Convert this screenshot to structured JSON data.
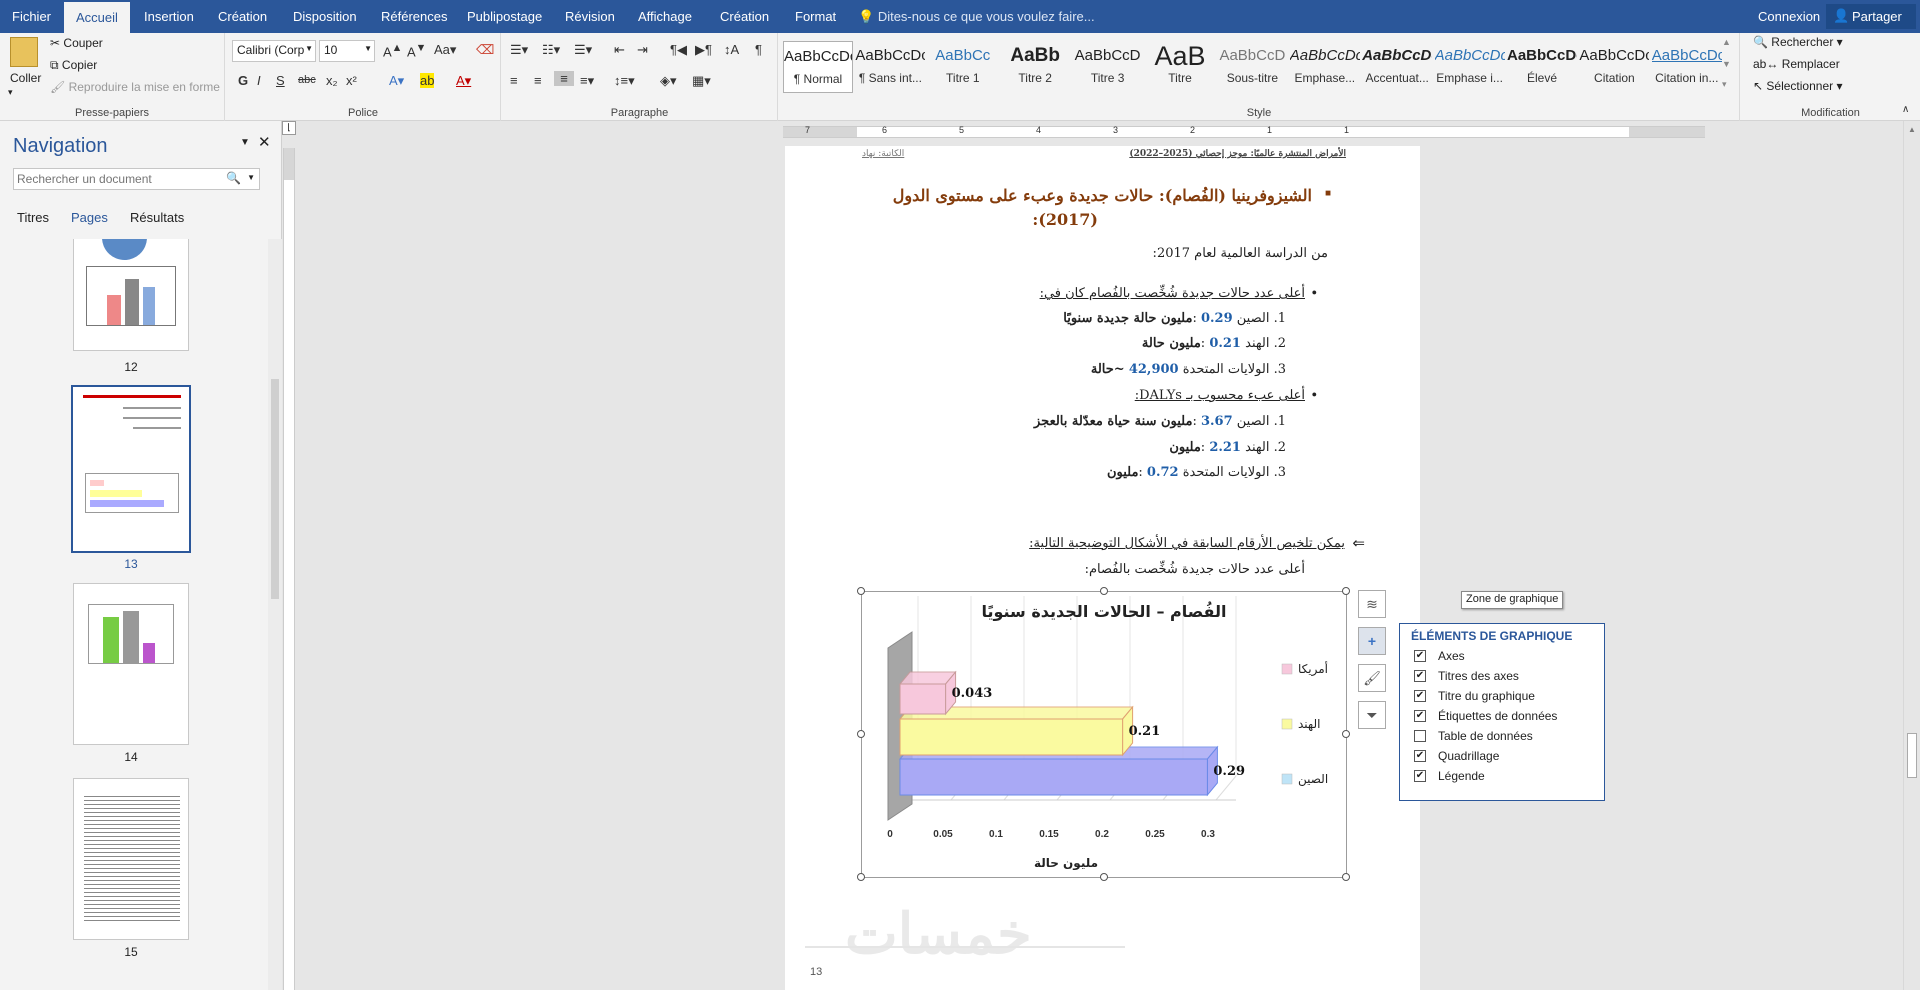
{
  "tabs": {
    "file": "Fichier",
    "home": "Accueil",
    "insert": "Insertion",
    "design": "Création",
    "layout": "Disposition",
    "references": "Références",
    "mailings": "Publipostage",
    "review": "Révision",
    "view": "Affichage",
    "chart_design": "Création",
    "format": "Format",
    "tell_me": "Dites-nous ce que vous voulez faire...",
    "signin": "Connexion",
    "share": "Partager"
  },
  "clipboard": {
    "paste": "Coller",
    "cut": "Couper",
    "copy": "Copier",
    "format_painter": "Reproduire la mise en forme",
    "label": "Presse-papiers"
  },
  "font": {
    "name": "Calibri (Corp",
    "size": "10",
    "label": "Police",
    "bold": "G",
    "italic": "I",
    "underline": "S",
    "strike": "abc",
    "sub": "x₂",
    "sup": "x²"
  },
  "paragraph": {
    "label": "Paragraphe"
  },
  "styles": {
    "label": "Style",
    "items": [
      {
        "preview": "AaBbCcDc",
        "name": "¶ Normal"
      },
      {
        "preview": "AaBbCcDc",
        "name": "¶ Sans int..."
      },
      {
        "preview": "AaBbCc",
        "name": "Titre 1"
      },
      {
        "preview": "AaBb",
        "name": "Titre 2"
      },
      {
        "preview": "AaBbCcD",
        "name": "Titre 3"
      },
      {
        "preview": "AaB",
        "name": "Titre"
      },
      {
        "preview": "AaBbCcD",
        "name": "Sous-titre"
      },
      {
        "preview": "AaBbCcDc",
        "name": "Emphase..."
      },
      {
        "preview": "AaBbCcDc",
        "name": "Accentuat..."
      },
      {
        "preview": "AaBbCcDc",
        "name": "Emphase i..."
      },
      {
        "preview": "AaBbCcDc",
        "name": "Élevé"
      },
      {
        "preview": "AaBbCcDc",
        "name": "Citation"
      },
      {
        "preview": "AaBbCcDc",
        "name": "Citation in..."
      }
    ]
  },
  "editing": {
    "find": "Rechercher",
    "replace": "Remplacer",
    "select": "Sélectionner",
    "label": "Modification"
  },
  "ruler": {
    "numbers": [
      "7",
      "6",
      "5",
      "4",
      "3",
      "2",
      "1",
      "1"
    ]
  },
  "nav": {
    "title": "Navigation",
    "search_placeholder": "Rechercher un document",
    "tabs": [
      "Titres",
      "Pages",
      "Résultats"
    ],
    "pages": [
      "12",
      "13",
      "14",
      "15"
    ]
  },
  "doc": {
    "header_left": "الكاتبة: نهاد",
    "header_right": "الأمراض المنتشرة عالميًا: موجز إحصائي (2025–2022)",
    "heading": "الشيزوفرينيا (الفُصام): حالات جديدة وعبء على مستوى الدول",
    "heading2": "(2017):",
    "source": "من الدراسة العالمية لعام 2017:",
    "bullet1": "أعلى عدد حالات جديدة شُخِّصت بالفُصام كان في:",
    "b1_items": [
      {
        "n": "1.",
        "country": "الصين",
        "val": "0.29",
        "unit": "مليون حالة جديدة سنويًا"
      },
      {
        "n": "2.",
        "country": "الهند",
        "val": "0.21",
        "unit": "مليون حالة"
      },
      {
        "n": "3.",
        "country": "الولايات المتحدة",
        "val": "42,900",
        "unit": "~حالة"
      }
    ],
    "bullet2": "أعلى عبء محسوب بـ DALYs:",
    "b2_items": [
      {
        "n": "1.",
        "country": "الصين",
        "val": "3.67",
        "unit": "مليون سنة حياة معدّلة بالعجز"
      },
      {
        "n": "2.",
        "country": "الهند",
        "val": "2.21",
        "unit": "مليون"
      },
      {
        "n": "3.",
        "country": "الولايات المتحدة",
        "val": "0.72",
        "unit": "مليون"
      }
    ],
    "summary": "يمكن تلخيص الأرقام السابقة في الأشكال التوضيحية التالية:",
    "caption": "أعلى عدد حالات جديدة شُخِّصت بالفُصام:",
    "page_number": "13",
    "watermark": "خمسات"
  },
  "chart_data": {
    "type": "bar",
    "orientation": "horizontal",
    "title": "الفُصام – الحالات الجديدة سنويًا",
    "xlabel": "مليون حالة",
    "categories": [
      "الصين",
      "الهند",
      "أمريكا"
    ],
    "values": [
      0.29,
      0.21,
      0.043
    ],
    "data_labels": [
      "0.29",
      "0.21",
      "0.043"
    ],
    "xlim": [
      0,
      0.3
    ],
    "ticks": [
      "0",
      "0.05",
      "0.1",
      "0.15",
      "0.2",
      "0.25",
      "0.3"
    ],
    "colors": [
      "#a9a9f5",
      "#fafaa0",
      "#f7c8dc"
    ],
    "legend": [
      "أمريكا",
      "الهند",
      "الصين"
    ],
    "legend_position": "right"
  },
  "tooltip": "Zone de graphique",
  "chart_elements": {
    "title": "ÉLÉMENTS DE GRAPHIQUE",
    "items": [
      {
        "label": "Axes",
        "checked": true
      },
      {
        "label": "Titres des axes",
        "checked": true
      },
      {
        "label": "Titre du graphique",
        "checked": true
      },
      {
        "label": "Étiquettes de données",
        "checked": true
      },
      {
        "label": "Table de données",
        "checked": false
      },
      {
        "label": "Quadrillage",
        "checked": true
      },
      {
        "label": "Légende",
        "checked": true
      }
    ]
  }
}
